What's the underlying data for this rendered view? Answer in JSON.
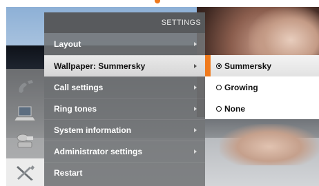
{
  "menu": {
    "title": "SETTINGS",
    "items": [
      {
        "label": "Layout",
        "has_submenu": true
      },
      {
        "label": "Wallpaper: Summersky",
        "has_submenu": true,
        "selected": true
      },
      {
        "label": "Call settings",
        "has_submenu": true
      },
      {
        "label": "Ring tones",
        "has_submenu": true
      },
      {
        "label": "System information",
        "has_submenu": true
      },
      {
        "label": "Administrator settings",
        "has_submenu": true
      },
      {
        "label": "Restart",
        "has_submenu": false
      }
    ]
  },
  "submenu": {
    "options": [
      {
        "label": "Summersky",
        "checked": true
      },
      {
        "label": "Growing",
        "checked": false
      },
      {
        "label": "None",
        "checked": false
      }
    ]
  },
  "rail": {
    "icons": [
      "phone-icon",
      "laptop-icon",
      "camera-icon",
      "tools-icon"
    ],
    "active": "tools-icon"
  },
  "colors": {
    "accent": "#f07a1d",
    "menu_bg": "#737578",
    "menu_header": "#56585b",
    "selected_row": "#e2e2e2"
  }
}
